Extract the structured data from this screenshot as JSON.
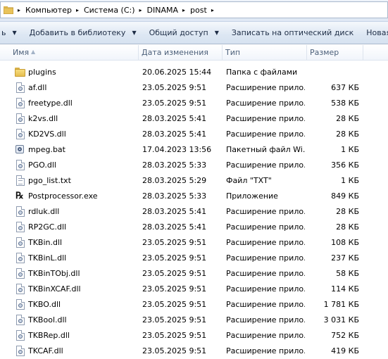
{
  "address": {
    "segments": [
      "Компьютер",
      "Система (C:)",
      "DINAMA",
      "post"
    ]
  },
  "toolbar": {
    "partial_label": "ь",
    "items": [
      "Добавить в библиотеку",
      "Общий доступ",
      "Записать на оптический диск",
      "Новая папка"
    ]
  },
  "columns": {
    "name": "Имя",
    "date": "Дата изменения",
    "type": "Тип",
    "size": "Размер"
  },
  "files": [
    {
      "icon": "folder-icon",
      "name": "plugins",
      "date": "20.06.2025 15:44",
      "type": "Папка с файлами",
      "size": ""
    },
    {
      "icon": "dll-file-icon",
      "name": "af.dll",
      "date": "23.05.2025 9:51",
      "type": "Расширение прило...",
      "size": "637 КБ"
    },
    {
      "icon": "dll-file-icon",
      "name": "freetype.dll",
      "date": "23.05.2025 9:51",
      "type": "Расширение прило...",
      "size": "538 КБ"
    },
    {
      "icon": "dll-file-icon",
      "name": "k2vs.dll",
      "date": "28.03.2025 5:41",
      "type": "Расширение прило...",
      "size": "28 КБ"
    },
    {
      "icon": "dll-file-icon",
      "name": "KD2VS.dll",
      "date": "28.03.2025 5:41",
      "type": "Расширение прило...",
      "size": "28 КБ"
    },
    {
      "icon": "batch-file-icon",
      "name": "mpeg.bat",
      "date": "17.04.2023 13:56",
      "type": "Пакетный файл Wi...",
      "size": "1 КБ"
    },
    {
      "icon": "dll-file-icon",
      "name": "PGO.dll",
      "date": "28.03.2025 5:33",
      "type": "Расширение прило...",
      "size": "356 КБ"
    },
    {
      "icon": "text-file-icon",
      "name": "pgo_list.txt",
      "date": "28.03.2025 5:29",
      "type": "Файл \"TXT\"",
      "size": "1 КБ"
    },
    {
      "icon": "exe-app-icon",
      "name": "Postprocessor.exe",
      "date": "28.03.2025 5:33",
      "type": "Приложение",
      "size": "849 КБ"
    },
    {
      "icon": "dll-file-icon",
      "name": "rdluk.dll",
      "date": "28.03.2025 5:41",
      "type": "Расширение прило...",
      "size": "28 КБ"
    },
    {
      "icon": "dll-file-icon",
      "name": "RP2GC.dll",
      "date": "28.03.2025 5:41",
      "type": "Расширение прило...",
      "size": "28 КБ"
    },
    {
      "icon": "dll-file-icon",
      "name": "TKBin.dll",
      "date": "23.05.2025 9:51",
      "type": "Расширение прило...",
      "size": "108 КБ"
    },
    {
      "icon": "dll-file-icon",
      "name": "TKBinL.dll",
      "date": "23.05.2025 9:51",
      "type": "Расширение прило...",
      "size": "237 КБ"
    },
    {
      "icon": "dll-file-icon",
      "name": "TKBinTObj.dll",
      "date": "23.05.2025 9:51",
      "type": "Расширение прило...",
      "size": "58 КБ"
    },
    {
      "icon": "dll-file-icon",
      "name": "TKBinXCAF.dll",
      "date": "23.05.2025 9:51",
      "type": "Расширение прило...",
      "size": "114 КБ"
    },
    {
      "icon": "dll-file-icon",
      "name": "TKBO.dll",
      "date": "23.05.2025 9:51",
      "type": "Расширение прило...",
      "size": "1 781 КБ"
    },
    {
      "icon": "dll-file-icon",
      "name": "TKBool.dll",
      "date": "23.05.2025 9:51",
      "type": "Расширение прило...",
      "size": "3 031 КБ"
    },
    {
      "icon": "dll-file-icon",
      "name": "TKBRep.dll",
      "date": "23.05.2025 9:51",
      "type": "Расширение прило...",
      "size": "752 КБ"
    },
    {
      "icon": "dll-file-icon",
      "name": "TKCAF.dll",
      "date": "23.05.2025 9:51",
      "type": "Расширение прило...",
      "size": "419 КБ"
    }
  ]
}
